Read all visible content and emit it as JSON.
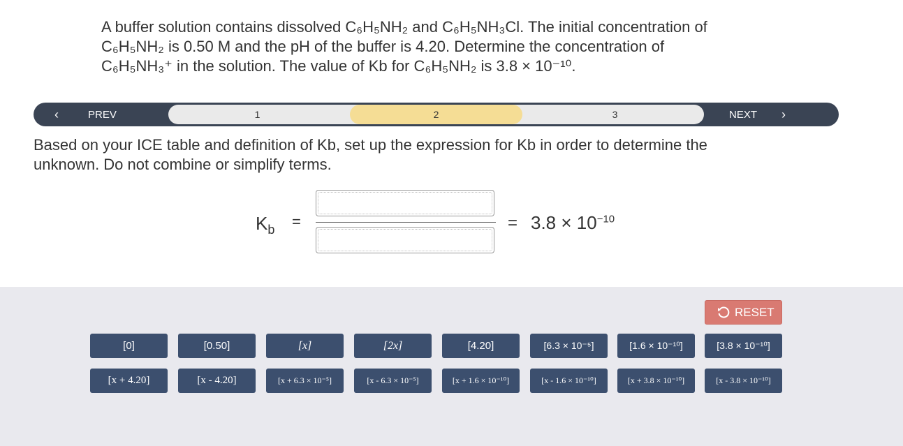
{
  "question": {
    "line1": "A buffer solution contains dissolved C₆H₅NH₂ and C₆H₅NH₃Cl. The initial concentration of",
    "line2": "C₆H₅NH₂ is 0.50 M and the pH of the buffer is 4.20. Determine the concentration of",
    "line3": "C₆H₅NH₃⁺ in the solution. The value of Kb for C₆H₅NH₂ is 3.8 × 10⁻¹⁰."
  },
  "stepper": {
    "prev_label": "PREV",
    "next_label": "NEXT",
    "steps": [
      "1",
      "2",
      "3"
    ],
    "active_step": "2"
  },
  "instruction": {
    "line1": "Based on your ICE table and definition of Kb, set up the expression for Kb in order to determine the",
    "line2": "unknown. Do not combine or simplify terms."
  },
  "equation": {
    "kb_symbol": "K",
    "kb_subscript": "b",
    "equals1": "=",
    "equals2": "=",
    "kb_value_base": "3.8 × 10",
    "kb_value_exp": "−10"
  },
  "reset_label": "RESET",
  "tiles_row1": [
    "[0]",
    "[0.50]",
    "[x]",
    "[2x]",
    "[4.20]",
    "[6.3 × 10⁻⁵]",
    "[1.6 × 10⁻¹⁰]",
    "[3.8 × 10⁻¹⁰]"
  ],
  "tiles_row2": [
    "[x + 4.20]",
    "[x - 4.20]",
    "[x + 6.3 × 10⁻⁵]",
    "[x - 6.3 × 10⁻⁵]",
    "[x + 1.6 × 10⁻¹⁰]",
    "[x - 1.6 × 10⁻¹⁰]",
    "[x + 3.8 × 10⁻¹⁰]",
    "[x - 3.8 × 10⁻¹⁰]"
  ],
  "icons": {
    "prev": "chevron-left-icon",
    "next": "chevron-right-icon",
    "reset": "undo-icon"
  },
  "colors": {
    "stepper_bg": "#3a4454",
    "active_step": "#f5dd95",
    "tile_bg": "#3c4f6e",
    "reset_bg": "#d97a72",
    "tray_bg": "#e9e9ee"
  }
}
